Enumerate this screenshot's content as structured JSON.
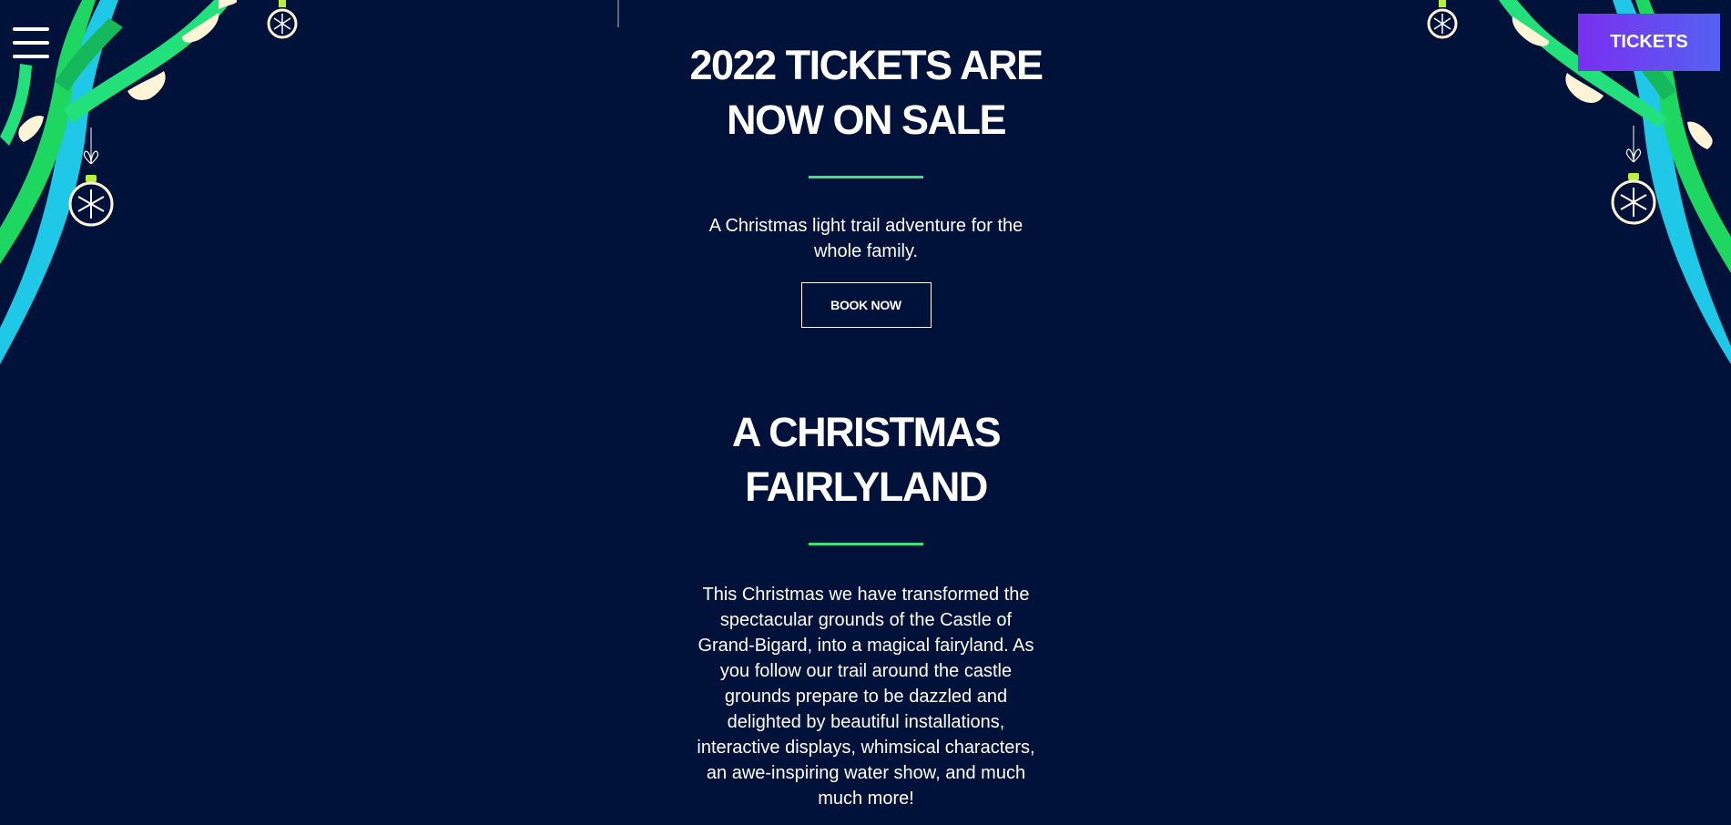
{
  "header": {
    "menu_icon": "hamburger-menu-icon",
    "tickets_label": "TICKETS"
  },
  "hero": {
    "heading_line1": "2022 TICKETS ARE",
    "heading_line2": "NOW ON SALE",
    "description_line1": "A Christmas light trail adventure for the",
    "description_line2": "whole family.",
    "button_label": "BOOK NOW"
  },
  "fairyland": {
    "heading_line1": "A CHRISTMAS",
    "heading_line2": "FAIRLYLAND",
    "paragraph_lines": [
      "This Christmas we have transformed the",
      "spectacular grounds of the Castle of",
      "Grand-Bigard, into a magical fairyland. As",
      "you follow our trail around the castle",
      "grounds prepare to be dazzled and",
      "delighted by beautiful installations,",
      "interactive displays, whimsical characters,",
      "an awe-inspiring water show, and much",
      "much more!"
    ]
  },
  "theme": {
    "background": "#00123a",
    "accent_green": "#3de07d",
    "tickets_gradient_start": "#7a2ff0",
    "tickets_gradient_end": "#5561f2",
    "branch_green": "#1ed760",
    "branch_cyan": "#1ec8e6",
    "snow": "#fff5d6"
  },
  "decorations": {
    "left": [
      "branch-decoration",
      "snowflake-ornament-icon",
      "snowflake-ornament-icon"
    ],
    "right": [
      "branch-decoration",
      "snowflake-ornament-icon",
      "snowflake-ornament-icon"
    ]
  }
}
